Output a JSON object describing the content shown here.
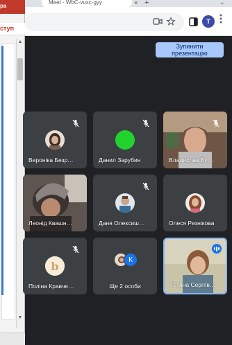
{
  "browser": {
    "tab_title": "Meet - WbC-vuxc-gyy",
    "new_tab_symbol": "+",
    "tab_close_symbol": "×",
    "tab_chevron_symbol": "⌄",
    "profile_initial": "T",
    "icons": [
      "camera-icon",
      "star-icon",
      "sidebar-icon",
      "profile-avatar",
      "menu-icon"
    ]
  },
  "side_window": {
    "title_text": "ра",
    "access_text": "ступ"
  },
  "meet": {
    "stop_presenting_line1": "Зупинити",
    "stop_presenting_line2": "презентацію",
    "more_others_initial": "К",
    "participants": [
      {
        "name": "Вероніка Безр…",
        "muted": true
      },
      {
        "name": "Данил Зарубин",
        "muted": true,
        "avatar_color": "#22d32d"
      },
      {
        "name": "Владислав Бу…",
        "muted": true
      },
      {
        "name": "Леонід Квашн…",
        "muted": false
      },
      {
        "name": "Даня Олексиш…",
        "muted": true
      },
      {
        "name": "Олеся Резнікова",
        "muted": false
      },
      {
        "name": "Поліна Кравче…",
        "muted": true,
        "avatar_letter": "b"
      },
      {
        "name": "Ще 2 особи",
        "muted": false
      },
      {
        "name": "Тетяна Сергіїв…",
        "muted": false,
        "speaking": true
      }
    ]
  },
  "colors": {
    "meet_bg": "#202124",
    "tile_bg": "#3c4043",
    "accent_blue": "#a8c7fa",
    "speaking_blue": "#8ab4f8"
  }
}
